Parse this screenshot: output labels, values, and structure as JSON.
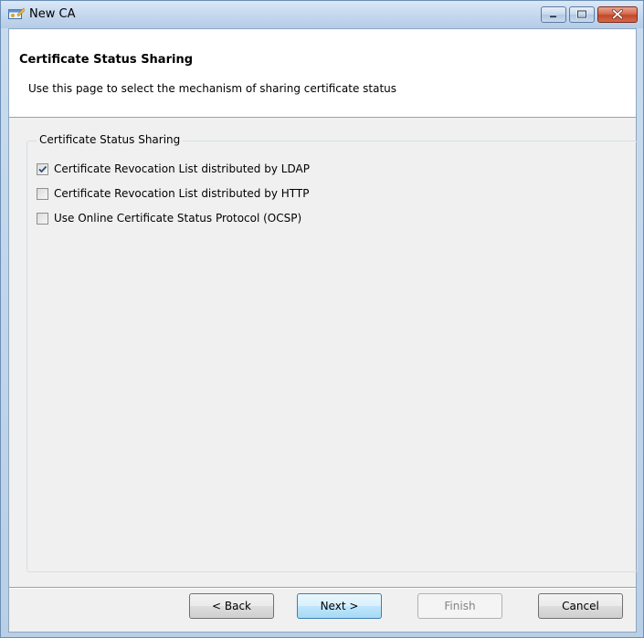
{
  "window": {
    "title": "New CA",
    "icon": "certificate-wizard-icon",
    "controls": [
      "minimize-icon",
      "maximize-icon",
      "close-icon"
    ]
  },
  "header": {
    "title": "Certificate Status Sharing",
    "description": "Use this page to select the mechanism of sharing certificate status"
  },
  "group": {
    "label": "Certificate Status Sharing",
    "options": [
      {
        "label": "Certificate Revocation List distributed by LDAP",
        "checked": true
      },
      {
        "label": "Certificate Revocation List distributed by HTTP",
        "checked": false
      },
      {
        "label": "Use Online Certificate Status Protocol (OCSP)",
        "checked": false
      }
    ]
  },
  "buttons": {
    "back": "< Back",
    "next": "Next >",
    "finish": "Finish",
    "finish_enabled": false,
    "cancel": "Cancel"
  },
  "colors": {
    "titlebar": "#c3d7ee",
    "close_button": "#c3482a",
    "dialog_background": "#f0f0f0",
    "header_background": "#ffffff",
    "default_button_border": "#3c7fb1",
    "disabled_text": "#838383"
  }
}
